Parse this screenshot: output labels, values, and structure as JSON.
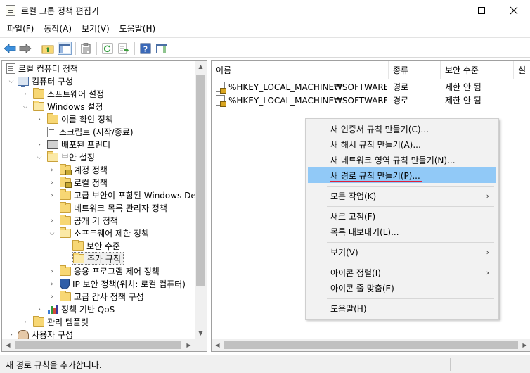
{
  "window": {
    "title": "로컬 그룹 정책 편집기"
  },
  "menu": [
    "파일(F)",
    "동작(A)",
    "보기(V)",
    "도움말(H)"
  ],
  "tree": [
    {
      "label": "로컬 컴퓨터 정책",
      "icon": "computer-policy-icon"
    },
    {
      "label": "컴퓨터 구성",
      "icon": "computer-icon"
    },
    {
      "label": "소프트웨어 설정",
      "icon": "folder-icon"
    },
    {
      "label": "Windows 설정",
      "icon": "folder-open-icon"
    },
    {
      "label": "이름 확인 정책",
      "icon": "folder-icon"
    },
    {
      "label": "스크립트 (시작/종료)",
      "icon": "script-icon"
    },
    {
      "label": "배포된 프린터",
      "icon": "printer-icon"
    },
    {
      "label": "보안 설정",
      "icon": "folder-open-icon"
    },
    {
      "label": "계정 정책",
      "icon": "secure-folder-icon"
    },
    {
      "label": "로컬 정책",
      "icon": "secure-folder-icon"
    },
    {
      "label": "고급 보안이 포함된 Windows Defender 방화벽",
      "icon": "folder-icon"
    },
    {
      "label": "네트워크 목록 관리자 정책",
      "icon": "folder-icon"
    },
    {
      "label": "공개 키 정책",
      "icon": "folder-icon"
    },
    {
      "label": "소프트웨어 제한 정책",
      "icon": "folder-open-icon"
    },
    {
      "label": "보안 수준",
      "icon": "folder-icon"
    },
    {
      "label": "추가 규칙",
      "icon": "folder-open-icon"
    },
    {
      "label": "응용 프로그램 제어 정책",
      "icon": "folder-icon"
    },
    {
      "label": "IP 보안 정책(위치: 로컬 컴퓨터)",
      "icon": "shield-icon"
    },
    {
      "label": "고급 감사 정책 구성",
      "icon": "folder-icon"
    },
    {
      "label": "정책 기반 QoS",
      "icon": "chart-icon"
    },
    {
      "label": "관리 템플릿",
      "icon": "folder-icon"
    },
    {
      "label": "사용자 구성",
      "icon": "user-icon"
    }
  ],
  "list": {
    "headers": [
      "이름",
      "종류",
      "보안 수준",
      "설"
    ],
    "rows": [
      {
        "name": "%HKEY_LOCAL_MACHINE₩SOFTWARE...",
        "type": "경로",
        "level": "제한 안 됨"
      },
      {
        "name": "%HKEY_LOCAL_MACHINE₩SOFTWARE...",
        "type": "경로",
        "level": "제한 안 됨"
      }
    ]
  },
  "context_menu": {
    "items": [
      {
        "label": "새 인증서 규칙 만들기(C)..."
      },
      {
        "label": "새 해시 규칙 만들기(A)..."
      },
      {
        "label": "새 네트워크 영역 규칙 만들기(N)..."
      },
      {
        "label": "새 경로 규칙 만들기(P)..."
      },
      {
        "label": "모든 작업(K)"
      },
      {
        "label": "새로 고침(F)"
      },
      {
        "label": "목록 내보내기(L)..."
      },
      {
        "label": "보기(V)"
      },
      {
        "label": "아이콘 정렬(I)"
      },
      {
        "label": "아이콘 줄 맞춤(E)"
      },
      {
        "label": "도움말(H)"
      }
    ],
    "highlight_color": "#91c9f7",
    "underline_color": "#e0203a"
  },
  "status": {
    "text": "새 경로 규칙을 추가합니다."
  }
}
